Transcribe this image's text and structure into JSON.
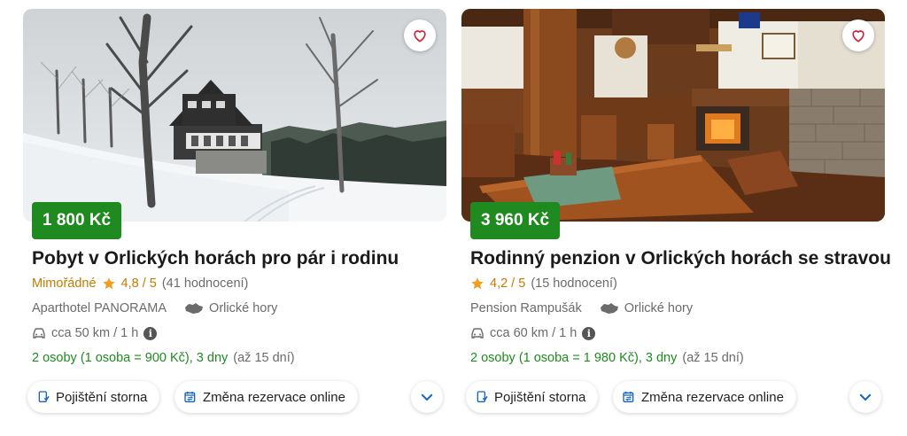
{
  "colors": {
    "price_bg": "#1f8a1f",
    "accent_green": "#1f8a1f",
    "excellent": "#c27a00",
    "star": "#f0a020",
    "blue": "#1565c0"
  },
  "cards": [
    {
      "price": "1 800 Kč",
      "title": "Pobyt v Orlických horách pro pár i rodinu",
      "rating_label": "Mimořádné",
      "score": "4,8 / 5",
      "reviews": "(41 hodnocení)",
      "hotel": "Aparthotel PANORAMA",
      "region": "Orlické hory",
      "distance": "cca 50 km / 1 h",
      "persons": "2 osoby (1 osoba = 900 Kč), 3 dny",
      "max_days": "(až 15 dní)",
      "insurance_label": "Pojištění storna",
      "change_label": "Změna rezervace online",
      "photo_icon": "winter-hotel-photo"
    },
    {
      "price": "3 960 Kč",
      "title": "Rodinný penzion v Orlických horách se stravou",
      "rating_label": "",
      "score": "4,2 / 5",
      "reviews": "(15 hodnocení)",
      "hotel": "Pension Rampušák",
      "region": "Orlické hory",
      "distance": "cca 60 km / 1 h",
      "persons": "2 osoby (1 osoba = 1 980 Kč), 3 dny",
      "max_days": "(až 15 dní)",
      "insurance_label": "Pojištění storna",
      "change_label": "Změna rezervace online",
      "photo_icon": "restaurant-interior-photo"
    }
  ]
}
